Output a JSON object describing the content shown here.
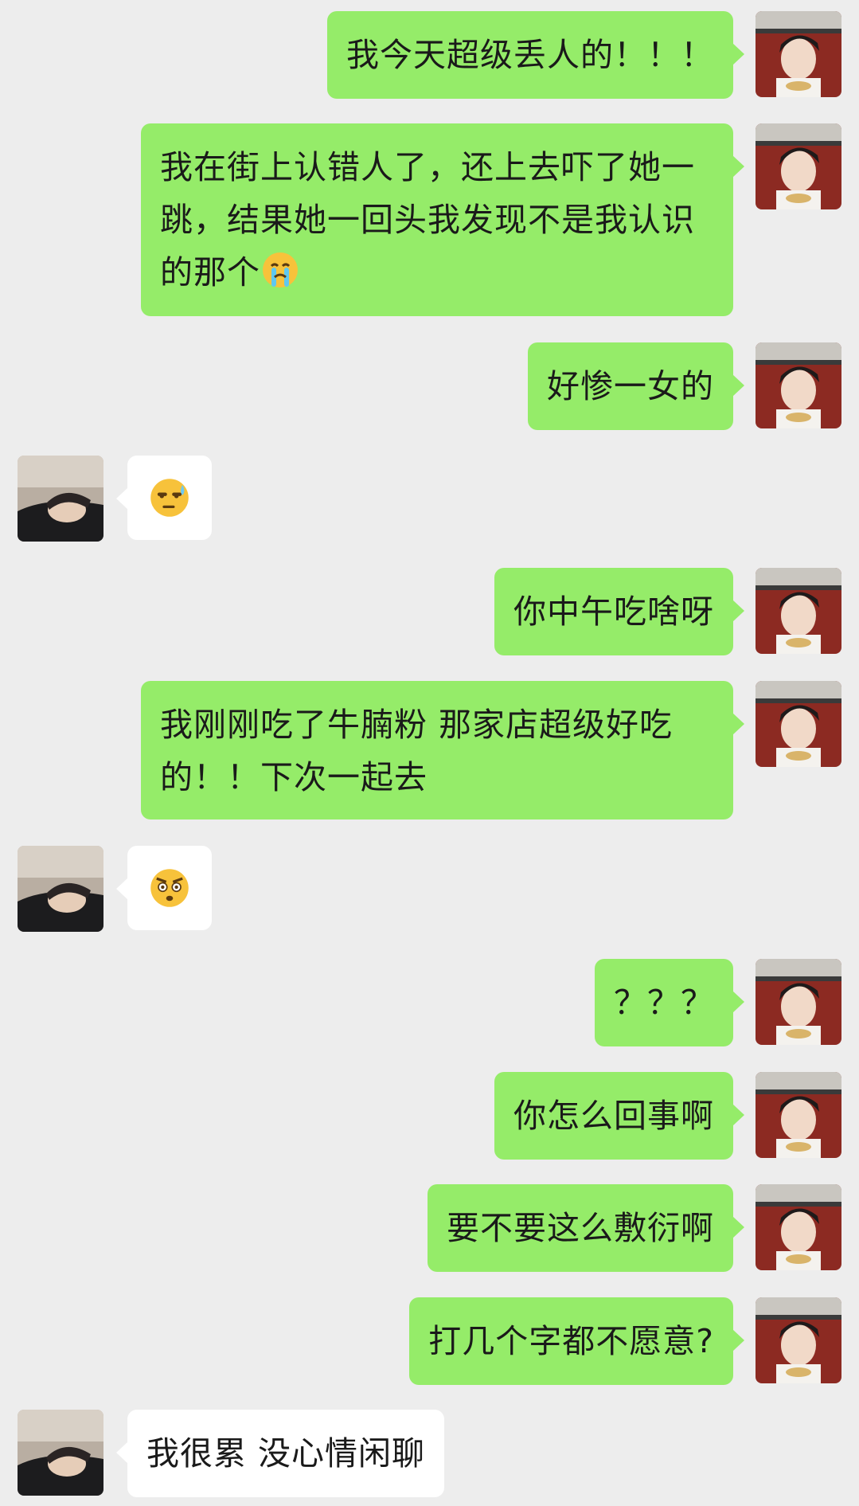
{
  "colors": {
    "background": "#ededed",
    "my_bubble": "#95ec69",
    "friend_bubble": "#ffffff"
  },
  "messages": [
    {
      "sender": "me",
      "text": "我今天超级丢人的！！！"
    },
    {
      "sender": "me",
      "text": "我在街上认错人了，还上去吓了她一跳，结果她一回头我发现不是我认识的那个",
      "emoji": "crying-face-icon"
    },
    {
      "sender": "me",
      "text": "好惨一女的"
    },
    {
      "sender": "friend",
      "emoji": "sweat-unamused-face-icon"
    },
    {
      "sender": "me",
      "text": "你中午吃啥呀"
    },
    {
      "sender": "me",
      "text": "我刚刚吃了牛腩粉  那家店超级好吃的！！下次一起去"
    },
    {
      "sender": "friend",
      "emoji": "flushed-angry-face-icon"
    },
    {
      "sender": "me",
      "text": "？？？"
    },
    {
      "sender": "me",
      "text": "你怎么回事啊"
    },
    {
      "sender": "me",
      "text": "要不要这么敷衍啊"
    },
    {
      "sender": "me",
      "text": "打几个字都不愿意?"
    },
    {
      "sender": "friend",
      "text": "我很累 没心情闲聊"
    }
  ]
}
